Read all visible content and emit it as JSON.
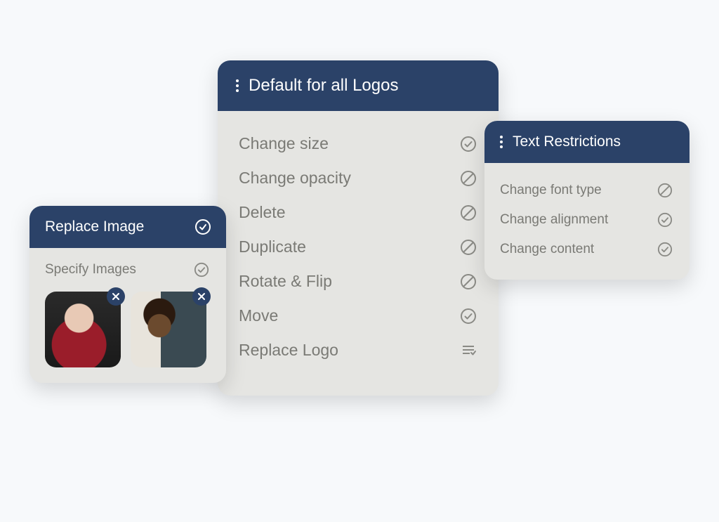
{
  "colors": {
    "header_bg": "#2b4268",
    "panel_bg": "#e5e5e2",
    "text_muted": "#7a7a75"
  },
  "main_panel": {
    "title": "Default for all Logos",
    "items": [
      {
        "label": "Change size",
        "status": "check"
      },
      {
        "label": "Change opacity",
        "status": "block"
      },
      {
        "label": "Delete",
        "status": "block"
      },
      {
        "label": "Duplicate",
        "status": "block"
      },
      {
        "label": "Rotate & Flip",
        "status": "block"
      },
      {
        "label": "Move",
        "status": "check"
      },
      {
        "label": "Replace Logo",
        "status": "list"
      }
    ]
  },
  "left_panel": {
    "title": "Replace Image",
    "header_status": "check",
    "section_label": "Specify Images",
    "section_status": "check",
    "thumbnails": [
      {
        "name": "image-thumb-1"
      },
      {
        "name": "image-thumb-2"
      }
    ]
  },
  "right_panel": {
    "title": "Text Restrictions",
    "items": [
      {
        "label": "Change font type",
        "status": "block"
      },
      {
        "label": "Change alignment",
        "status": "check"
      },
      {
        "label": "Change content",
        "status": "check"
      }
    ]
  }
}
